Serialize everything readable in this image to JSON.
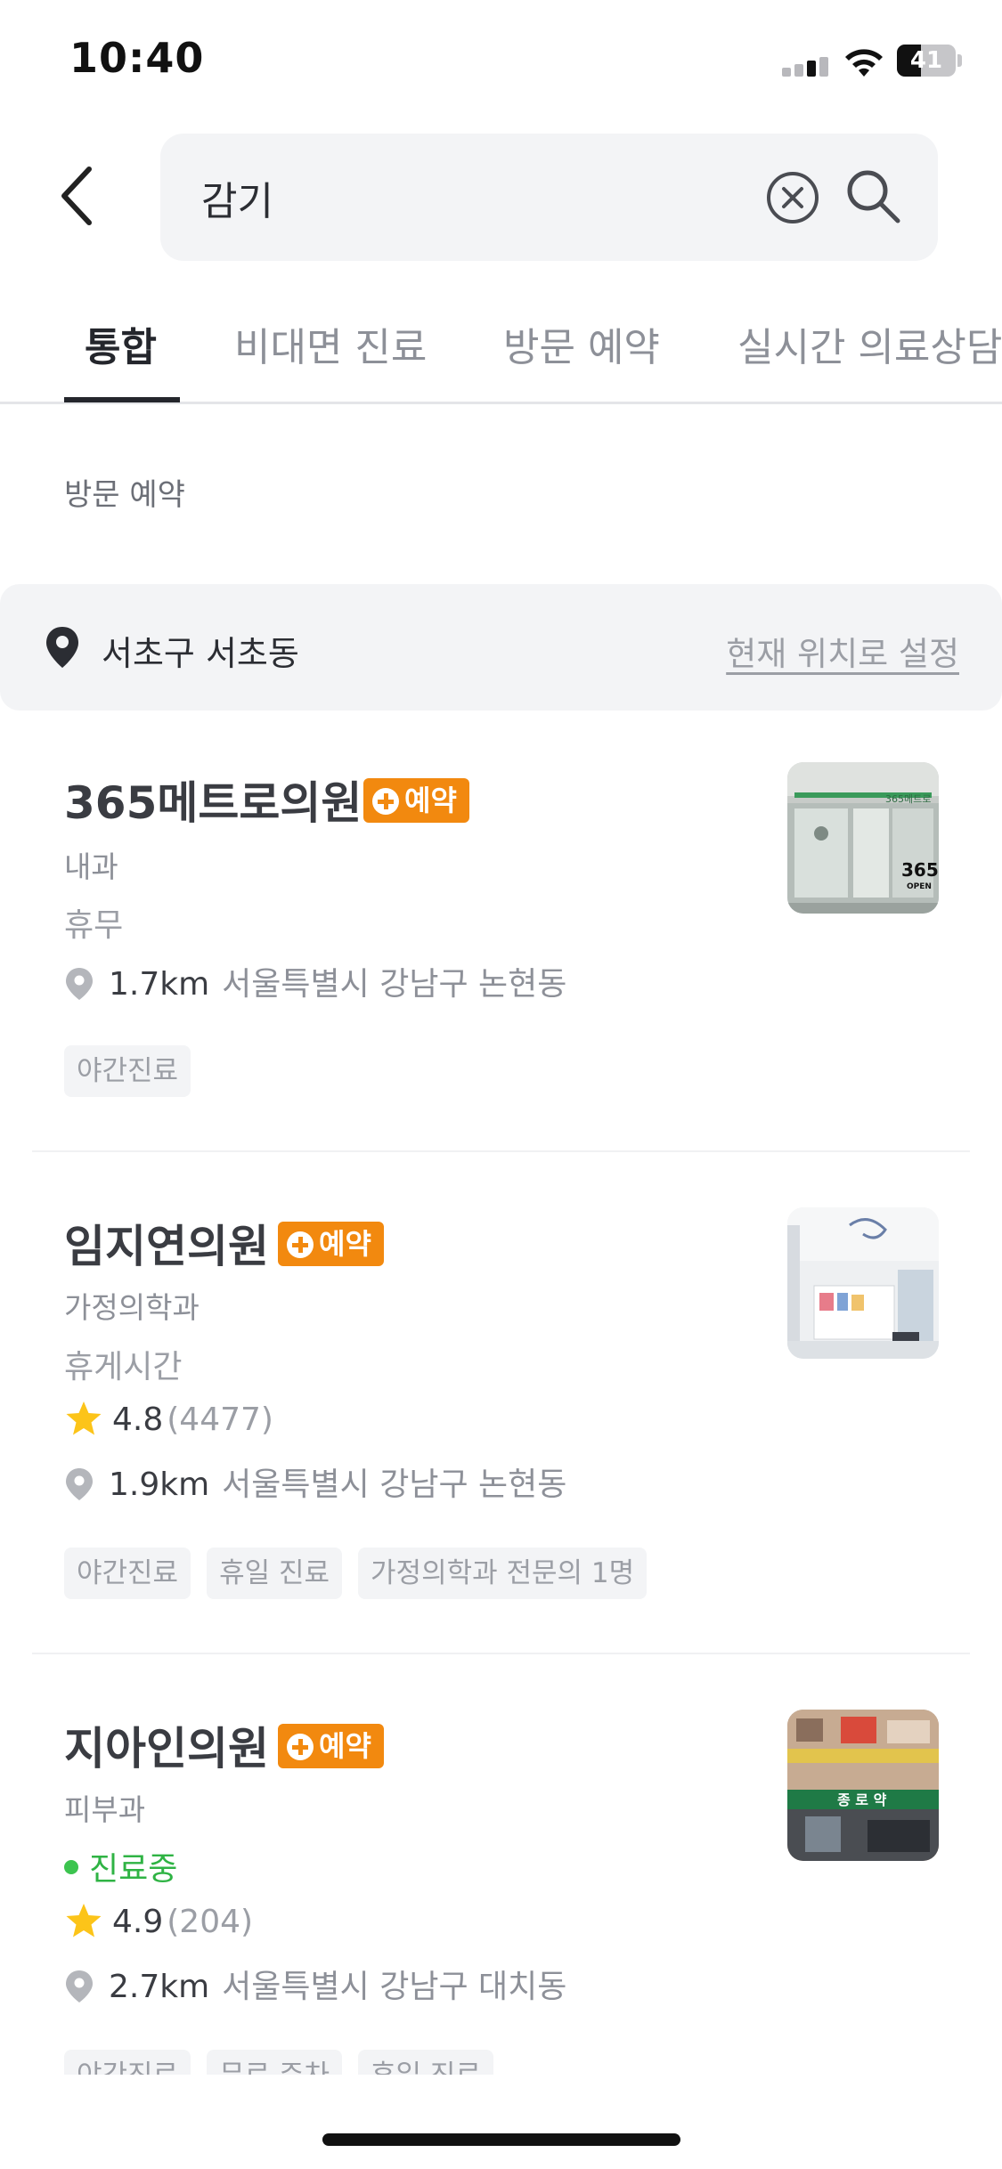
{
  "status_bar": {
    "time": "10:40",
    "battery": "41",
    "battery_fraction": 0.41,
    "icons": [
      "cellular-signal-icon",
      "wifi-icon",
      "battery-icon"
    ]
  },
  "search": {
    "query": "감기",
    "icons": [
      "back-arrow-icon",
      "clear-icon",
      "search-icon"
    ]
  },
  "tabs": [
    {
      "label": "통합",
      "active": true
    },
    {
      "label": "비대면 진료",
      "active": false
    },
    {
      "label": "방문 예약",
      "active": false
    },
    {
      "label": "실시간 의료상담",
      "active": false
    }
  ],
  "section_label": "방문 예약",
  "location": {
    "current": "서초구 서초동",
    "set_current_link": "현재 위치로 설정",
    "icon": "location-pin-icon"
  },
  "colors": {
    "accent_orange": "#f2890f",
    "open_green": "#2fb344",
    "star_yellow": "#fcc419"
  },
  "clinics": [
    {
      "name": "365메트로의원",
      "badge": "예약",
      "department": "내과",
      "status": "휴무",
      "distance": "1.7km",
      "address": "서울특별시 강남구 논현동",
      "tags": [
        "야간진료"
      ]
    },
    {
      "name": "임지연의원",
      "badge": "예약",
      "department": "가정의학과",
      "status": "휴게시간",
      "rating": "4.8",
      "review_count": "(4477)",
      "distance": "1.9km",
      "address": "서울특별시 강남구 논현동",
      "tags": [
        "야간진료",
        "휴일 진료",
        "가정의학과 전문의 1명"
      ]
    },
    {
      "name": "지아인의원",
      "badge": "예약",
      "department": "피부과",
      "status": "진료중",
      "rating": "4.9",
      "review_count": "(204)",
      "distance": "2.7km",
      "address": "서울특별시 강남구 대치동",
      "tags": [
        "야간진료",
        "무료 주차",
        "휴일 진료"
      ]
    }
  ],
  "photo_signs": {
    "clinic1_sign": "365메트로",
    "clinic1_window": "365",
    "clinic1_window_sub": "OPEN",
    "clinic3_pharmacy_sign": "종 로 약"
  }
}
